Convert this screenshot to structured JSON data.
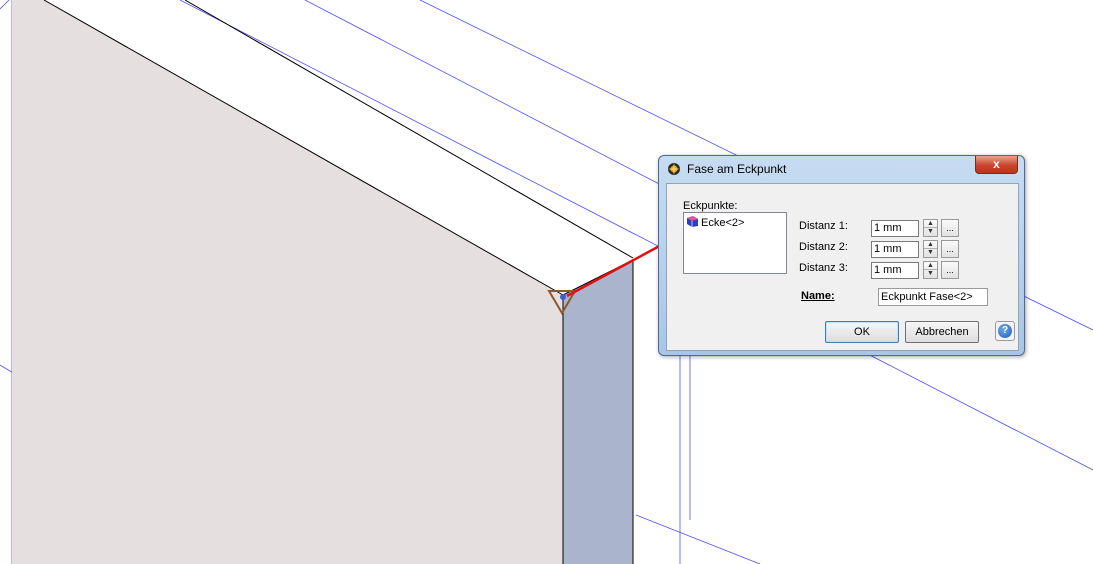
{
  "dialog": {
    "title": "Fase am Eckpunkt",
    "close_label": "x",
    "eckpunkte_label": "Eckpunkte:",
    "eckpunkte_items": [
      {
        "label": "Ecke<2>"
      }
    ],
    "distances": [
      {
        "label": "Distanz 1:",
        "value": "1 mm",
        "more_label": "..."
      },
      {
        "label": "Distanz 2:",
        "value": "1 mm",
        "more_label": "..."
      },
      {
        "label": "Distanz 3:",
        "value": "1 mm",
        "more_label": "..."
      }
    ],
    "name_label": "Name:",
    "name_value": "Eckpunkt Fase<2>",
    "ok_label": "OK",
    "cancel_label": "Abbrechen",
    "help_label": "?"
  },
  "colors": {
    "front_face": "#e6dfdf",
    "side_face": "#aab4cc",
    "construction_lines": "#5050ff",
    "arrow": "#e01010",
    "chamfer_marker": "#8b5a2b"
  },
  "icons": {
    "title": "fase-tool-icon",
    "list_item": "vertex-icon",
    "help": "help-icon"
  }
}
